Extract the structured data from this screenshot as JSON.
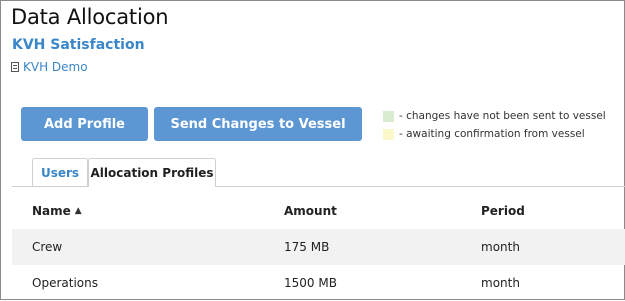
{
  "page": {
    "title": "Data Allocation",
    "subtitle": "KVH Satisfaction",
    "vessel_name": "KVH Demo"
  },
  "toolbar": {
    "add_profile_label": "Add Profile",
    "send_changes_label": "Send Changes to Vessel",
    "button_color": "#5d97d3"
  },
  "legend": {
    "items": [
      {
        "label": "- changes have not been sent to vessel",
        "color": "#d9ecd0"
      },
      {
        "label": "- awaiting confirmation from vessel",
        "color": "#fbf9cc"
      }
    ]
  },
  "tabs": [
    {
      "label": "Users",
      "active": false
    },
    {
      "label": "Allocation Profiles",
      "active": true
    }
  ],
  "table": {
    "columns": [
      "Name",
      "Amount",
      "Period"
    ],
    "sort_indicator": "▲",
    "rows": [
      {
        "name": "Crew",
        "amount": "175 MB",
        "period": "month"
      },
      {
        "name": "Operations",
        "amount": "1500 MB",
        "period": "month"
      }
    ]
  },
  "icons": {
    "vessel": "document-icon",
    "sort": "sort-ascending-icon"
  }
}
